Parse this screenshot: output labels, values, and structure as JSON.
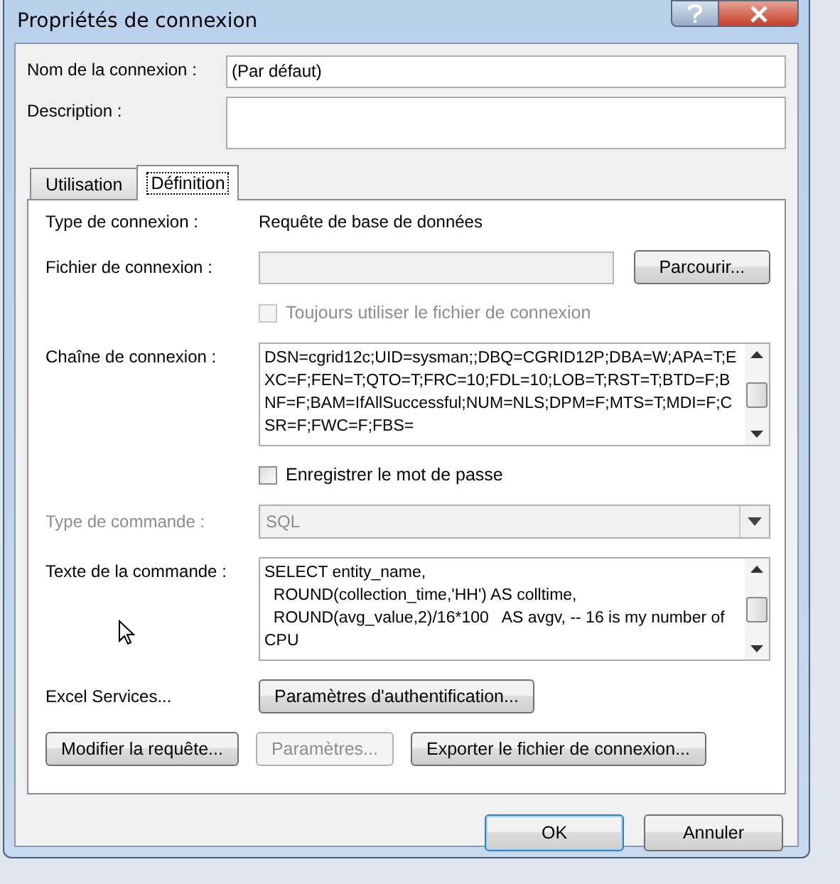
{
  "window": {
    "title": "Propriétés de connexion"
  },
  "connection_name": {
    "label": "Nom de la connexion :",
    "value": "(Par défaut)"
  },
  "description": {
    "label": "Description :"
  },
  "tabs": [
    {
      "label": "Utilisation",
      "selected": false
    },
    {
      "label": "Définition",
      "selected": true
    }
  ],
  "definition": {
    "connection_type": {
      "label": "Type de connexion :",
      "value": "Requête de base de données"
    },
    "connection_file": {
      "label": "Fichier de connexion :",
      "browse_button": "Parcourir..."
    },
    "always_use_file": {
      "label": "Toujours utiliser le fichier de connexion",
      "checked": false,
      "disabled": true
    },
    "connection_string": {
      "label": "Chaîne de connexion :",
      "value": "DSN=cgrid12c;UID=sysman;;DBQ=CGRID12P;DBA=W;APA=T;EXC=F;FEN=T;QTO=T;FRC=10;FDL=10;LOB=T;RST=T;BTD=F;BNF=F;BAM=IfAllSuccessful;NUM=NLS;DPM=F;MTS=T;MDI=F;CSR=F;FWC=F;FBS="
    },
    "save_password": {
      "label": "Enregistrer le mot de passe",
      "checked": false,
      "disabled": false
    },
    "command_type": {
      "label": "Type de commande :",
      "value": "SQL",
      "disabled": true
    },
    "command_text": {
      "label": "Texte de la commande :",
      "value": "SELECT entity_name,\n  ROUND(collection_time,'HH') AS colltime,\n  ROUND(avg_value,2)/16*100   AS avgv, -- 16 is my number of CPU"
    },
    "excel_services": {
      "label": "Excel Services...",
      "button": "Paramètres d'authentification..."
    },
    "buttons": [
      {
        "label": "Modifier la requête...",
        "disabled": false
      },
      {
        "label": "Paramètres...",
        "disabled": true
      },
      {
        "label": "Exporter le fichier de connexion...",
        "disabled": false
      }
    ]
  },
  "footer_buttons": [
    {
      "label": "OK",
      "default": true
    },
    {
      "label": "Annuler",
      "default": false
    }
  ]
}
